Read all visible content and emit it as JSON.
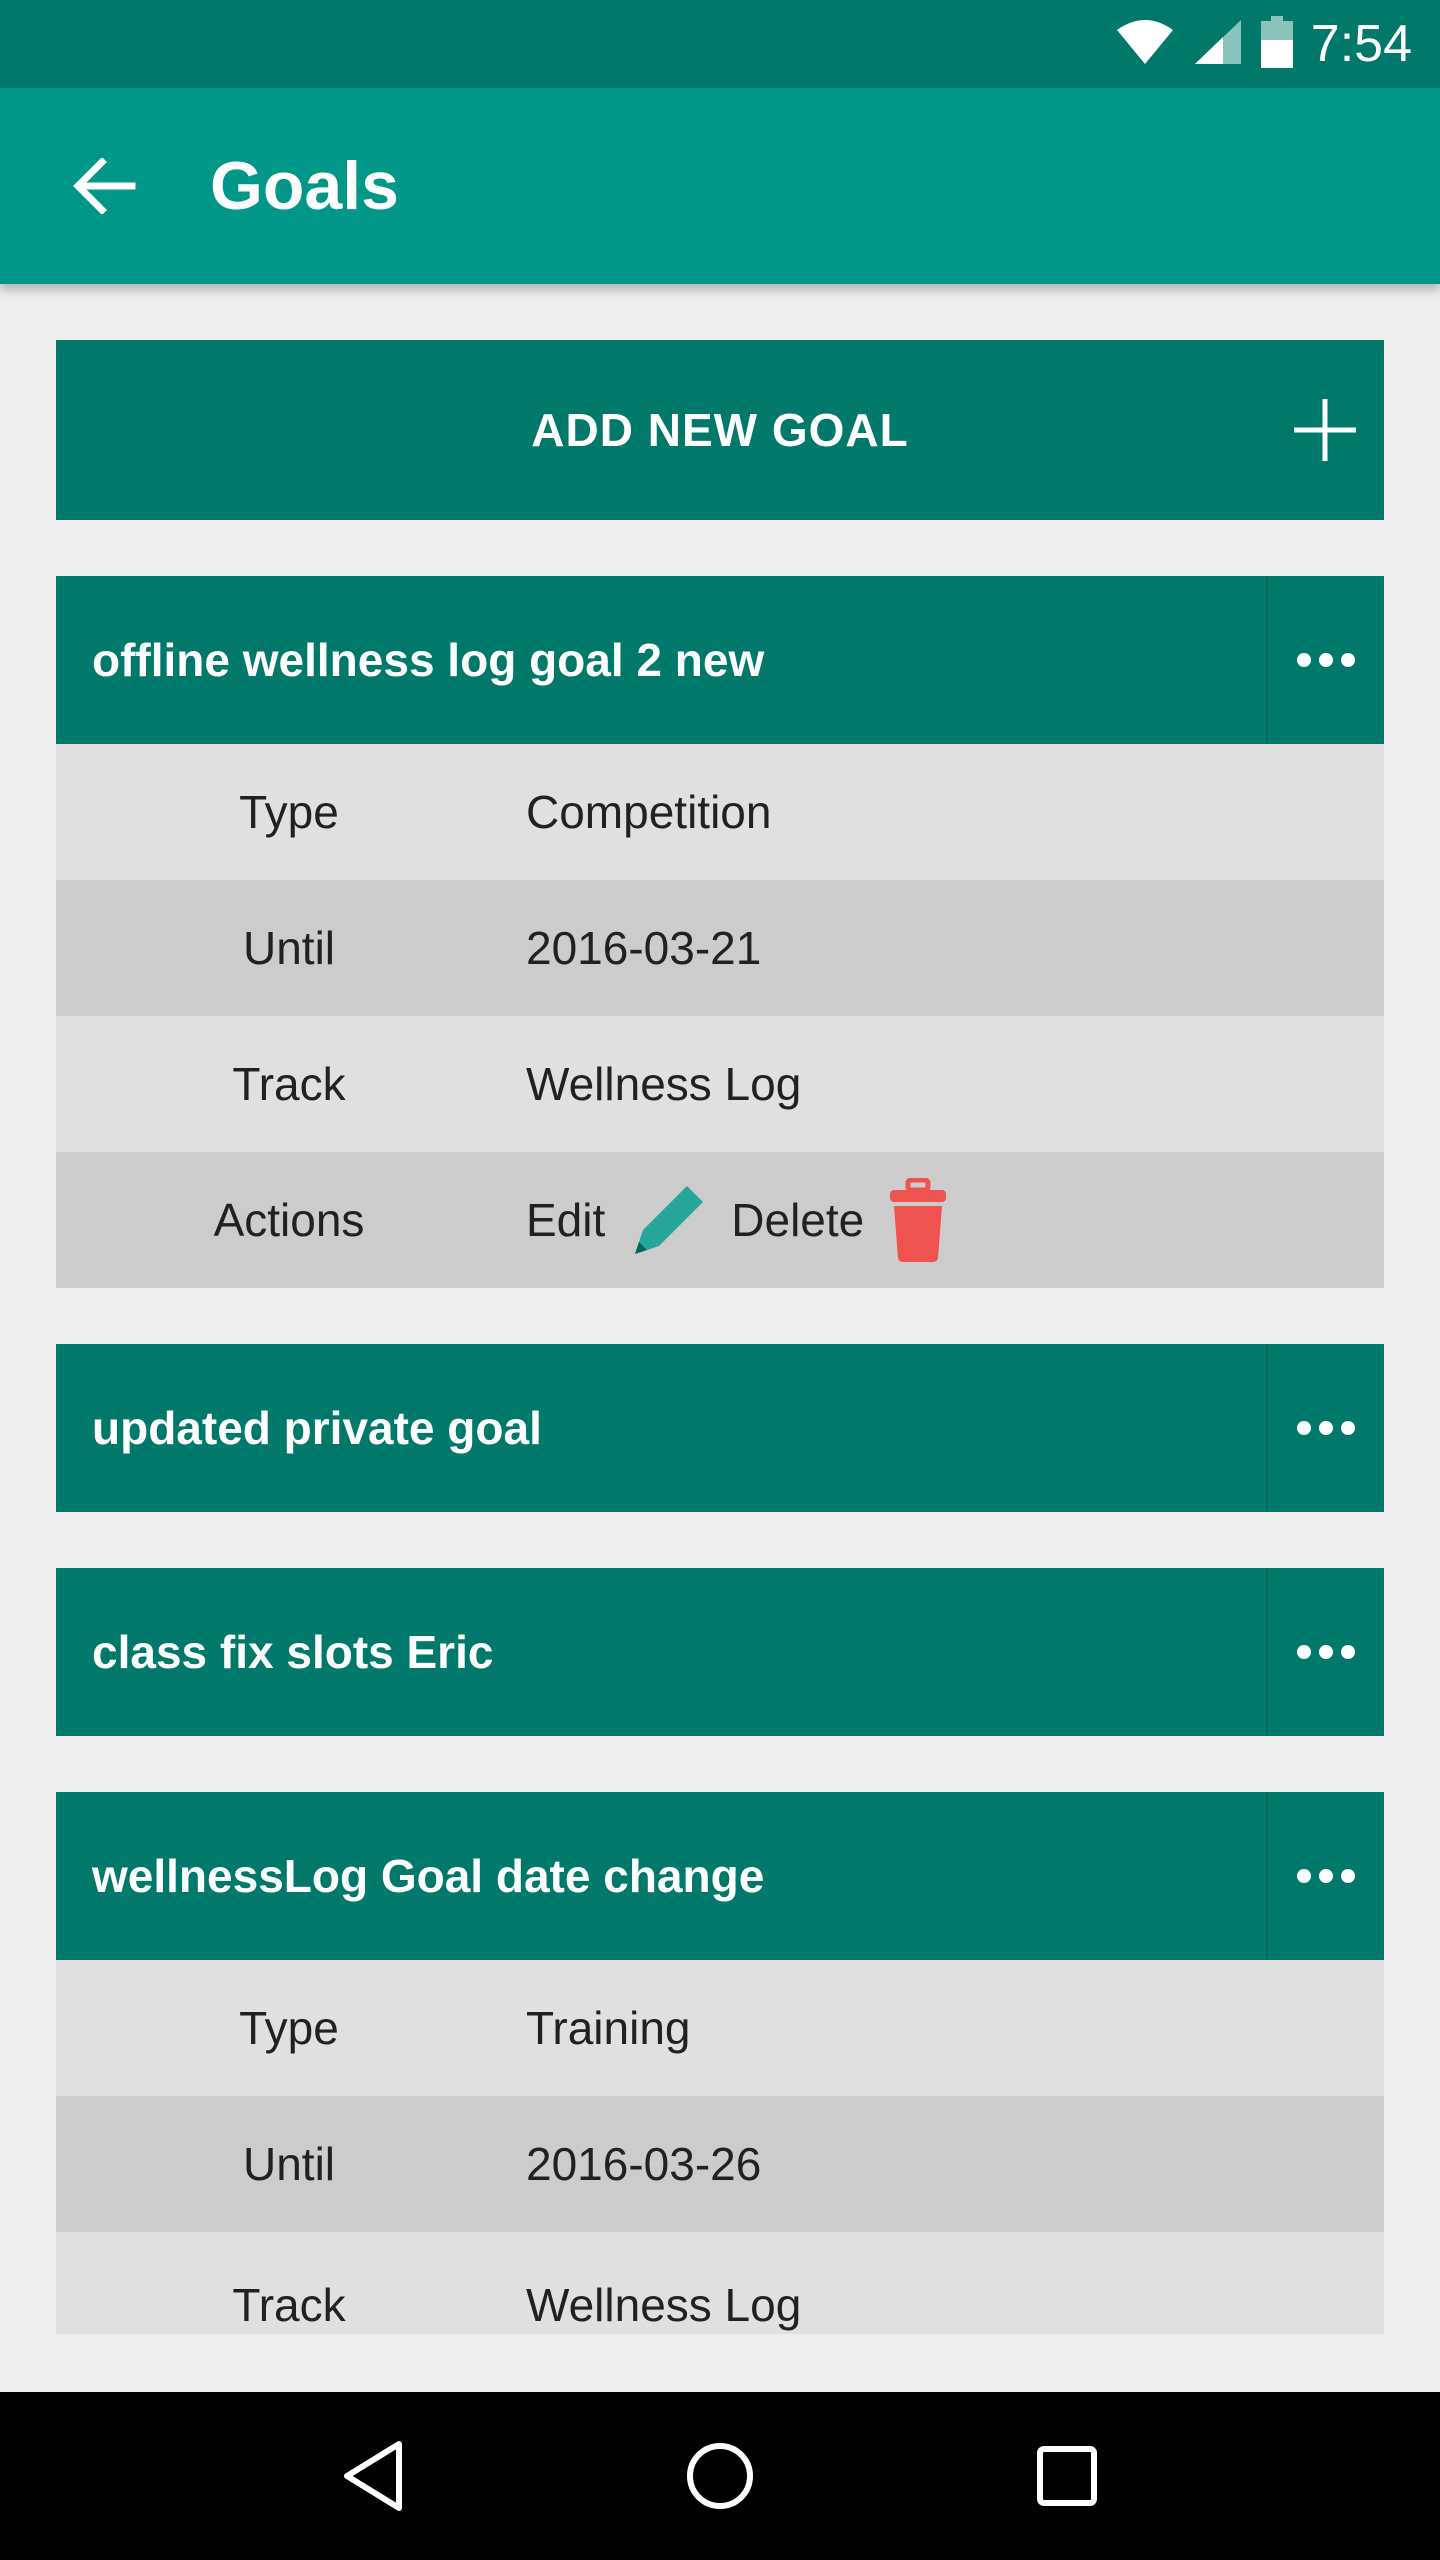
{
  "status_bar": {
    "time": "7:54",
    "icons": [
      "wifi-icon",
      "signal-icon",
      "battery-icon"
    ]
  },
  "app_bar": {
    "title": "Goals",
    "back_icon": "arrow-left-icon"
  },
  "add_goal": {
    "label": "ADD NEW GOAL",
    "icon": "plus-icon"
  },
  "goals": [
    {
      "title": "offline wellness log goal 2 new",
      "expanded": true,
      "details": [
        {
          "label": "Type",
          "value": "Competition"
        },
        {
          "label": "Until",
          "value": "2016-03-21"
        },
        {
          "label": "Track",
          "value": "Wellness Log"
        }
      ],
      "actions": {
        "label": "Actions",
        "edit": "Edit",
        "delete": "Delete"
      }
    },
    {
      "title": "updated private goal",
      "expanded": false
    },
    {
      "title": "class fix slots Eric",
      "expanded": false
    },
    {
      "title": "wellnessLog Goal date change",
      "expanded": true,
      "details": [
        {
          "label": "Type",
          "value": "Training"
        },
        {
          "label": "Until",
          "value": "2016-03-26"
        },
        {
          "label": "Track",
          "value": "Wellness Log"
        }
      ]
    }
  ],
  "colors": {
    "status_bar": "#00796b",
    "app_bar": "#009688",
    "card_header": "#00796b",
    "row_light": "#e0e0e0",
    "row_dark": "#cccccc",
    "edit_icon": "#26a69a",
    "delete_icon": "#ef5350"
  },
  "nav_bar": {
    "icons": [
      "back-triangle-icon",
      "home-circle-icon",
      "recents-square-icon"
    ]
  }
}
